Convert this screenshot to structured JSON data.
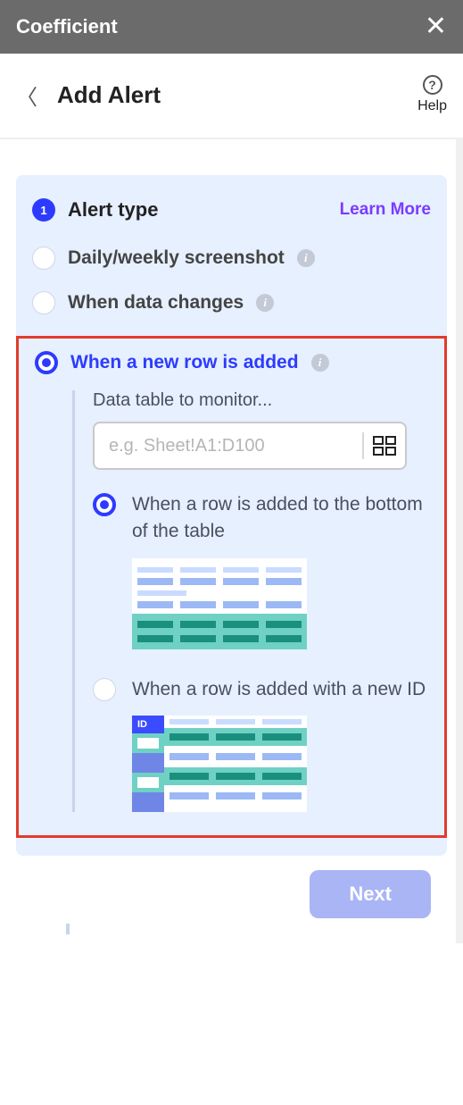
{
  "app_name": "Coefficient",
  "page_title": "Add Alert",
  "help_label": "Help",
  "card": {
    "step_number": "1",
    "step_title": "Alert type",
    "learn_more": "Learn More",
    "options": {
      "daily": "Daily/weekly screenshot",
      "data_changes": "When data changes",
      "new_row": "When a new row is added"
    },
    "nested": {
      "title": "Data table to monitor...",
      "placeholder": "e.g. Sheet!A1:D100",
      "sub_options": {
        "bottom": "When a row is added to the bottom of the table",
        "new_id": "When a row is added with a new ID"
      },
      "id_label": "ID"
    }
  },
  "footer": {
    "next": "Next"
  }
}
